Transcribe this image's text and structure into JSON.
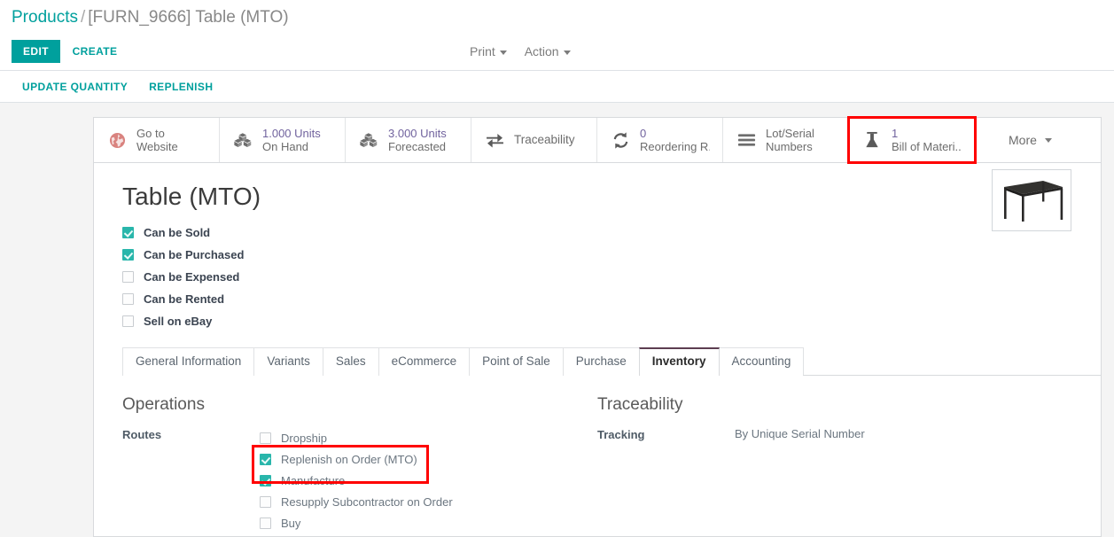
{
  "breadcrumb": {
    "root": "Products",
    "separator": "/",
    "current": "[FURN_9666] Table (MTO)"
  },
  "control_panel": {
    "edit_label": "EDIT",
    "create_label": "CREATE",
    "print_label": "Print",
    "action_label": "Action"
  },
  "action_bar": {
    "update_quantity_label": "UPDATE QUANTITY",
    "replenish_label": "REPLENISH"
  },
  "stat_buttons": [
    {
      "icon": "globe-icon",
      "line1": "Go to",
      "line2": "Website",
      "style": "plain",
      "highlighted": false
    },
    {
      "icon": "boxes-icon",
      "line1": "1.000 Units",
      "line2": "On Hand",
      "style": "value",
      "highlighted": false
    },
    {
      "icon": "boxes-icon",
      "line1": "3.000 Units",
      "line2": "Forecasted",
      "style": "value",
      "highlighted": false
    },
    {
      "icon": "exchange-icon",
      "line1": "Traceability",
      "line2": "",
      "style": "single",
      "highlighted": false
    },
    {
      "icon": "refresh-icon",
      "line1": "0",
      "line2": "Reordering R...",
      "style": "value",
      "highlighted": false
    },
    {
      "icon": "bars-icon",
      "line1": "Lot/Serial",
      "line2": "Numbers",
      "style": "plain",
      "highlighted": false
    },
    {
      "icon": "flask-icon",
      "line1": "1",
      "line2": "Bill of Materi...",
      "style": "value",
      "highlighted": true
    }
  ],
  "more_button": {
    "label": "More",
    "icon": "chevron-down-icon"
  },
  "product": {
    "title": "Table (MTO)",
    "image_alt": "table-product-photo",
    "checkboxes": [
      {
        "label": "Can be Sold",
        "checked": true
      },
      {
        "label": "Can be Purchased",
        "checked": true
      },
      {
        "label": "Can be Expensed",
        "checked": false
      },
      {
        "label": "Can be Rented",
        "checked": false
      },
      {
        "label": "Sell on eBay",
        "checked": false
      }
    ]
  },
  "tabs": [
    {
      "label": "General Information",
      "active": false
    },
    {
      "label": "Variants",
      "active": false
    },
    {
      "label": "Sales",
      "active": false
    },
    {
      "label": "eCommerce",
      "active": false
    },
    {
      "label": "Point of Sale",
      "active": false
    },
    {
      "label": "Purchase",
      "active": false
    },
    {
      "label": "Inventory",
      "active": true
    },
    {
      "label": "Accounting",
      "active": false
    }
  ],
  "inventory_tab": {
    "operations": {
      "title": "Operations",
      "routes_label": "Routes",
      "routes": [
        {
          "label": "Dropship",
          "checked": false
        },
        {
          "label": "Replenish on Order (MTO)",
          "checked": true
        },
        {
          "label": "Manufacture",
          "checked": true
        },
        {
          "label": "Resupply Subcontractor on Order",
          "checked": false
        },
        {
          "label": "Buy",
          "checked": false
        }
      ]
    },
    "traceability": {
      "title": "Traceability",
      "tracking_label": "Tracking",
      "tracking_value": "By Unique Serial Number"
    }
  },
  "colors": {
    "accent": "#00A09D",
    "checkbox_on": "#29b6ab",
    "stat_value": "#71639e",
    "highlight": "#ff0000",
    "globe": "#d9837f"
  }
}
